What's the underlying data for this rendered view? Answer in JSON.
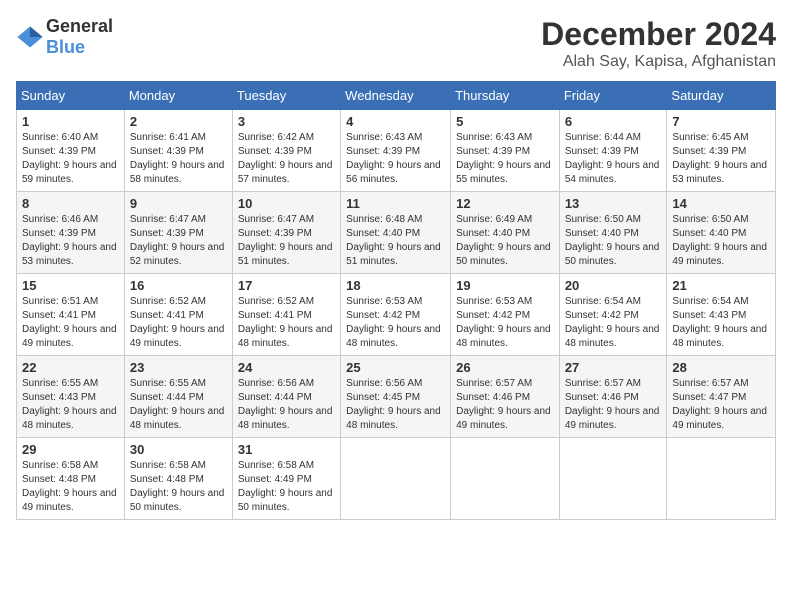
{
  "header": {
    "logo_general": "General",
    "logo_blue": "Blue",
    "month_title": "December 2024",
    "location": "Alah Say, Kapisa, Afghanistan"
  },
  "weekdays": [
    "Sunday",
    "Monday",
    "Tuesday",
    "Wednesday",
    "Thursday",
    "Friday",
    "Saturday"
  ],
  "weeks": [
    [
      {
        "day": "1",
        "sunrise": "6:40 AM",
        "sunset": "4:39 PM",
        "daylight": "9 hours and 59 minutes."
      },
      {
        "day": "2",
        "sunrise": "6:41 AM",
        "sunset": "4:39 PM",
        "daylight": "9 hours and 58 minutes."
      },
      {
        "day": "3",
        "sunrise": "6:42 AM",
        "sunset": "4:39 PM",
        "daylight": "9 hours and 57 minutes."
      },
      {
        "day": "4",
        "sunrise": "6:43 AM",
        "sunset": "4:39 PM",
        "daylight": "9 hours and 56 minutes."
      },
      {
        "day": "5",
        "sunrise": "6:43 AM",
        "sunset": "4:39 PM",
        "daylight": "9 hours and 55 minutes."
      },
      {
        "day": "6",
        "sunrise": "6:44 AM",
        "sunset": "4:39 PM",
        "daylight": "9 hours and 54 minutes."
      },
      {
        "day": "7",
        "sunrise": "6:45 AM",
        "sunset": "4:39 PM",
        "daylight": "9 hours and 53 minutes."
      }
    ],
    [
      {
        "day": "8",
        "sunrise": "6:46 AM",
        "sunset": "4:39 PM",
        "daylight": "9 hours and 53 minutes."
      },
      {
        "day": "9",
        "sunrise": "6:47 AM",
        "sunset": "4:39 PM",
        "daylight": "9 hours and 52 minutes."
      },
      {
        "day": "10",
        "sunrise": "6:47 AM",
        "sunset": "4:39 PM",
        "daylight": "9 hours and 51 minutes."
      },
      {
        "day": "11",
        "sunrise": "6:48 AM",
        "sunset": "4:40 PM",
        "daylight": "9 hours and 51 minutes."
      },
      {
        "day": "12",
        "sunrise": "6:49 AM",
        "sunset": "4:40 PM",
        "daylight": "9 hours and 50 minutes."
      },
      {
        "day": "13",
        "sunrise": "6:50 AM",
        "sunset": "4:40 PM",
        "daylight": "9 hours and 50 minutes."
      },
      {
        "day": "14",
        "sunrise": "6:50 AM",
        "sunset": "4:40 PM",
        "daylight": "9 hours and 49 minutes."
      }
    ],
    [
      {
        "day": "15",
        "sunrise": "6:51 AM",
        "sunset": "4:41 PM",
        "daylight": "9 hours and 49 minutes."
      },
      {
        "day": "16",
        "sunrise": "6:52 AM",
        "sunset": "4:41 PM",
        "daylight": "9 hours and 49 minutes."
      },
      {
        "day": "17",
        "sunrise": "6:52 AM",
        "sunset": "4:41 PM",
        "daylight": "9 hours and 48 minutes."
      },
      {
        "day": "18",
        "sunrise": "6:53 AM",
        "sunset": "4:42 PM",
        "daylight": "9 hours and 48 minutes."
      },
      {
        "day": "19",
        "sunrise": "6:53 AM",
        "sunset": "4:42 PM",
        "daylight": "9 hours and 48 minutes."
      },
      {
        "day": "20",
        "sunrise": "6:54 AM",
        "sunset": "4:42 PM",
        "daylight": "9 hours and 48 minutes."
      },
      {
        "day": "21",
        "sunrise": "6:54 AM",
        "sunset": "4:43 PM",
        "daylight": "9 hours and 48 minutes."
      }
    ],
    [
      {
        "day": "22",
        "sunrise": "6:55 AM",
        "sunset": "4:43 PM",
        "daylight": "9 hours and 48 minutes."
      },
      {
        "day": "23",
        "sunrise": "6:55 AM",
        "sunset": "4:44 PM",
        "daylight": "9 hours and 48 minutes."
      },
      {
        "day": "24",
        "sunrise": "6:56 AM",
        "sunset": "4:44 PM",
        "daylight": "9 hours and 48 minutes."
      },
      {
        "day": "25",
        "sunrise": "6:56 AM",
        "sunset": "4:45 PM",
        "daylight": "9 hours and 48 minutes."
      },
      {
        "day": "26",
        "sunrise": "6:57 AM",
        "sunset": "4:46 PM",
        "daylight": "9 hours and 49 minutes."
      },
      {
        "day": "27",
        "sunrise": "6:57 AM",
        "sunset": "4:46 PM",
        "daylight": "9 hours and 49 minutes."
      },
      {
        "day": "28",
        "sunrise": "6:57 AM",
        "sunset": "4:47 PM",
        "daylight": "9 hours and 49 minutes."
      }
    ],
    [
      {
        "day": "29",
        "sunrise": "6:58 AM",
        "sunset": "4:48 PM",
        "daylight": "9 hours and 49 minutes."
      },
      {
        "day": "30",
        "sunrise": "6:58 AM",
        "sunset": "4:48 PM",
        "daylight": "9 hours and 50 minutes."
      },
      {
        "day": "31",
        "sunrise": "6:58 AM",
        "sunset": "4:49 PM",
        "daylight": "9 hours and 50 minutes."
      },
      null,
      null,
      null,
      null
    ]
  ],
  "labels": {
    "sunrise_prefix": "Sunrise: ",
    "sunset_prefix": "Sunset: ",
    "daylight_prefix": "Daylight: "
  }
}
